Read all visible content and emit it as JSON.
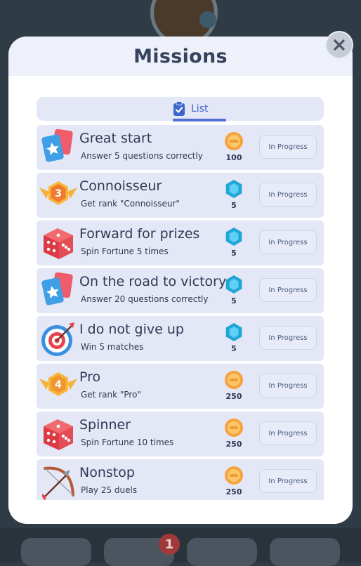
{
  "modal": {
    "title": "Missions"
  },
  "tabs": {
    "list_label": "List"
  },
  "missions": [
    {
      "title": "Great start",
      "desc": "Answer 5 questions correctly",
      "icon": "cards-icon",
      "reward_icon": "coin-icon",
      "reward": "100",
      "status": "In Progress"
    },
    {
      "title": "Connoisseur",
      "desc": "Get rank \"Connoisseur\"",
      "icon": "rank-badge-icon",
      "rank": "3",
      "reward_icon": "gem-icon",
      "reward": "5",
      "status": "In Progress"
    },
    {
      "title": "Forward for prizes",
      "desc": "Spin Fortune 5 times",
      "icon": "dice-icon",
      "reward_icon": "gem-icon",
      "reward": "5",
      "status": "In Progress"
    },
    {
      "title": "On the road to victory",
      "desc": "Answer 20 questions correctly",
      "icon": "cards-icon",
      "reward_icon": "gem-icon",
      "reward": "5",
      "status": "In Progress"
    },
    {
      "title": "I do not give up",
      "desc": "Win 5 matches",
      "icon": "target-icon",
      "reward_icon": "gem-icon",
      "reward": "5",
      "status": "In Progress"
    },
    {
      "title": "Pro",
      "desc": "Get rank \"Pro\"",
      "icon": "rank-badge-icon",
      "rank": "4",
      "reward_icon": "coin-icon",
      "reward": "250",
      "status": "In Progress"
    },
    {
      "title": "Spinner",
      "desc": "Spin Fortune 10 times",
      "icon": "dice-icon",
      "reward_icon": "coin-icon",
      "reward": "250",
      "status": "In Progress"
    },
    {
      "title": "Nonstop",
      "desc": "Play 25 duels",
      "icon": "bow-icon",
      "reward_icon": "coin-icon",
      "reward": "250",
      "status": "In Progress"
    }
  ],
  "background": {
    "notification_count": "1"
  },
  "colors": {
    "accent": "#4f6fd6",
    "row_bg": "#e4e7f6",
    "coin": "#f5a33a",
    "gem": "#1fa6d8"
  }
}
